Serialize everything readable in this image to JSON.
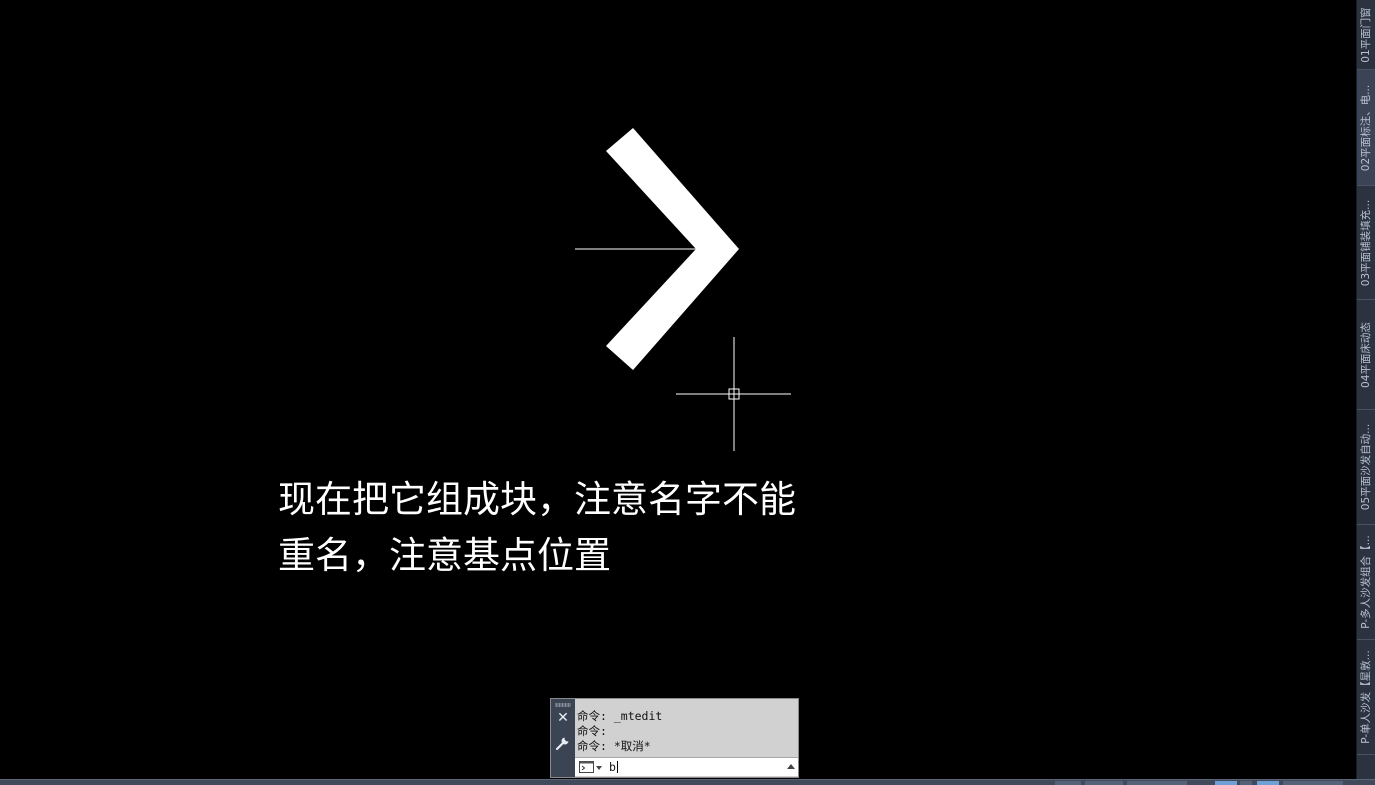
{
  "annotation": {
    "line1": "现在把它组成块，注意名字不能",
    "line2": "重名，注意基点位置"
  },
  "command_window": {
    "history": [
      "命令: _mtedit",
      "命令:",
      "命令: *取消*"
    ],
    "input_value": "b",
    "close_icon": "close-icon",
    "settings_icon": "wrench-icon",
    "prompt_icon": "command-prompt-icon",
    "recent_icon": "triangle-up-icon",
    "colors": {
      "panel": "#d1d1d1",
      "side": "#3b4453"
    }
  },
  "file_tabs": [
    "01平面门窗",
    "02平面标注、电...",
    "03平面铺装填充...",
    "04平面床动态",
    "05平面沙发自动...",
    "P-多人沙发组合【...",
    "P-单人沙发【星敦..."
  ],
  "colors": {
    "canvas": "#000000",
    "geometry": "#ffffff",
    "sidebar": "#2b3340"
  },
  "icons": {
    "crosshair": "crosshair-cursor-icon"
  }
}
